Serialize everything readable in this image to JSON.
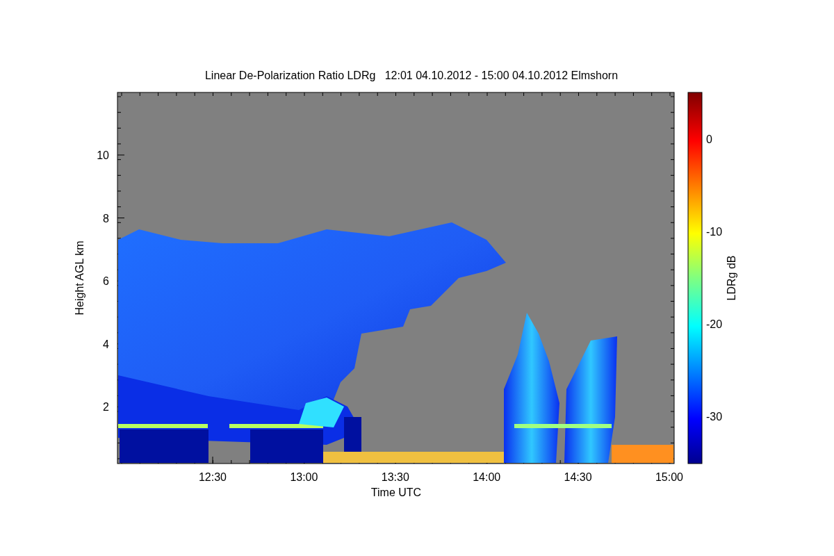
{
  "title": "Linear De-Polarization Ratio LDRg   12:01 04.10.2012 - 15:00 04.10.2012 Elmshorn",
  "x_axis": {
    "label": "Time UTC",
    "ticks": [
      "12:30",
      "13:00",
      "13:30",
      "14:00",
      "14:30",
      "15:00"
    ]
  },
  "y_axis": {
    "label": "Height AGL km",
    "ticks": [
      "10",
      "8",
      "6",
      "4",
      "2"
    ]
  },
  "colorbar": {
    "label": "LDRg dB",
    "ticks": [
      "0",
      "-10",
      "-20",
      "-30"
    ]
  }
}
